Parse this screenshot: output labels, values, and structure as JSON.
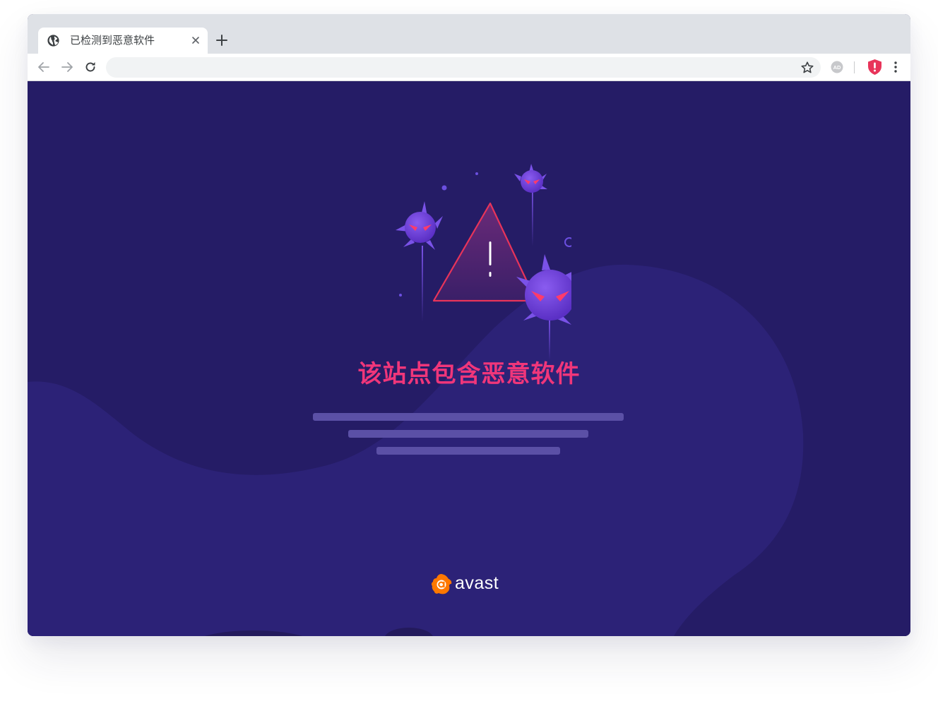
{
  "browser": {
    "tab": {
      "title": "已检测到恶意软件",
      "favicon_icon": "globe-icon",
      "close_icon": "close-icon"
    },
    "new_tab_icon": "plus-icon",
    "toolbar": {
      "back_icon": "arrow-left-icon",
      "forward_icon": "arrow-right-icon",
      "reload_icon": "reload-icon",
      "address_value": "",
      "bookmark_icon": "star-icon",
      "adblock_extension_label": "AD",
      "security_extension_icon": "shield-alert-icon",
      "menu_icon": "more-vertical-icon"
    }
  },
  "page": {
    "headline": "该站点包含恶意软件",
    "illustration": "warning-triangle-with-virus-icons",
    "logo_text": "avast",
    "logo_icon": "avast-logo-icon"
  },
  "colors": {
    "background": "#251c66",
    "background_blob": "#2c2277",
    "headline": "#f0367a",
    "placeholder_bar": "#5b50a6",
    "virus": "#7040e0",
    "alert_accent": "#e8345a",
    "logo_orange": "#ff7800"
  }
}
